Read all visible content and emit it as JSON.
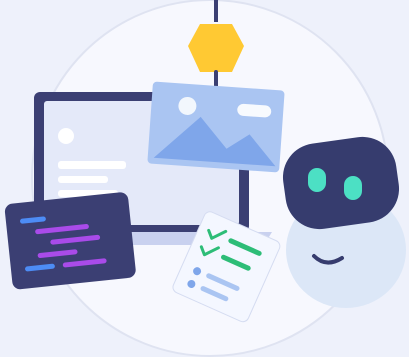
{
  "illustration": {
    "colors": {
      "background": "#eef1fb",
      "circle": "#f7f8fe",
      "circle_outline": "#dfe3f1",
      "laptop_frame": "#3b3f73",
      "laptop_screen": "#e4e9f9",
      "laptop_base": "#c9d1ef",
      "photo_card": "#aac5f2",
      "photo_mountain": "#7fa6ea",
      "hook_block": "#ffc933",
      "hook_metal": "#3b3f73",
      "code_panel": "#3b3f73",
      "code_line_purple": "#a94be9",
      "code_line_blue": "#4d8cf5",
      "checklist_paper": "#f4f7ff",
      "check_green": "#2dbd77",
      "robot_head": "#363c6e",
      "robot_eye": "#4ce0c4",
      "robot_body": "#dce7f7"
    },
    "icons": [
      "crane-hook-icon",
      "image-icon",
      "laptop-icon",
      "code-editor-icon",
      "checklist-icon",
      "robot-icon"
    ]
  }
}
